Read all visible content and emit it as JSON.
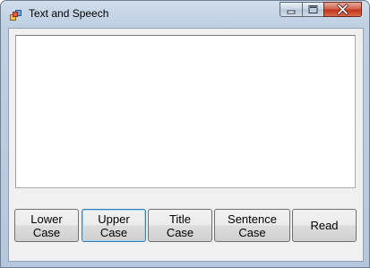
{
  "window": {
    "title": "Text and Speech"
  },
  "textbox": {
    "value": ""
  },
  "buttons": {
    "lower_case": "Lower\nCase",
    "upper_case": "Upper\nCase",
    "title_case": "Title\nCase",
    "sentence_case": "Sentence\nCase",
    "read": "Read"
  }
}
